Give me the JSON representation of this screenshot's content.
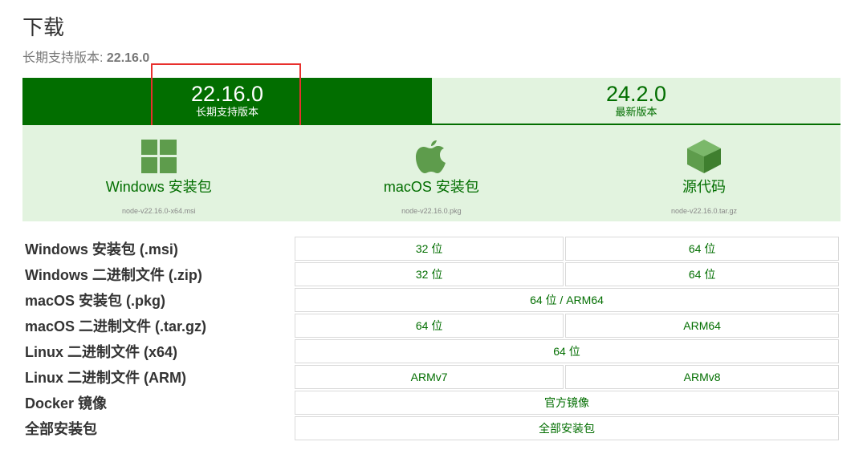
{
  "page": {
    "title": "下载",
    "lts_prefix": "长期支持版本: ",
    "lts_version": "22.16.0"
  },
  "tabs": [
    {
      "version": "22.16.0",
      "label": "长期支持版本"
    },
    {
      "version": "24.2.0",
      "label": "最新版本"
    }
  ],
  "downloads": [
    {
      "icon": "windows-icon",
      "label": "Windows 安装包",
      "file": "node-v22.16.0-x64.msi"
    },
    {
      "icon": "apple-icon",
      "label": "macOS 安装包",
      "file": "node-v22.16.0.pkg"
    },
    {
      "icon": "cube-icon",
      "label": "源代码",
      "file": "node-v22.16.0.tar.gz"
    }
  ],
  "table": [
    {
      "label": "Windows 安装包 (.msi)",
      "cells": [
        "32 位",
        "64 位"
      ]
    },
    {
      "label": "Windows 二进制文件 (.zip)",
      "cells": [
        "32 位",
        "64 位"
      ]
    },
    {
      "label": "macOS 安装包 (.pkg)",
      "cells": [
        "64 位 / ARM64"
      ]
    },
    {
      "label": "macOS 二进制文件 (.tar.gz)",
      "cells": [
        "64 位",
        "ARM64"
      ]
    },
    {
      "label": "Linux 二进制文件 (x64)",
      "cells": [
        "64 位"
      ]
    },
    {
      "label": "Linux 二进制文件 (ARM)",
      "cells": [
        "ARMv7",
        "ARMv8"
      ]
    },
    {
      "label": "Docker 镜像",
      "cells": [
        "官方镜像"
      ]
    },
    {
      "label": "全部安装包",
      "cells": [
        "全部安装包"
      ]
    }
  ],
  "colors": {
    "brand_green": "#026e00",
    "light_green": "#e2f3df",
    "highlight_red": "#e8302d"
  }
}
